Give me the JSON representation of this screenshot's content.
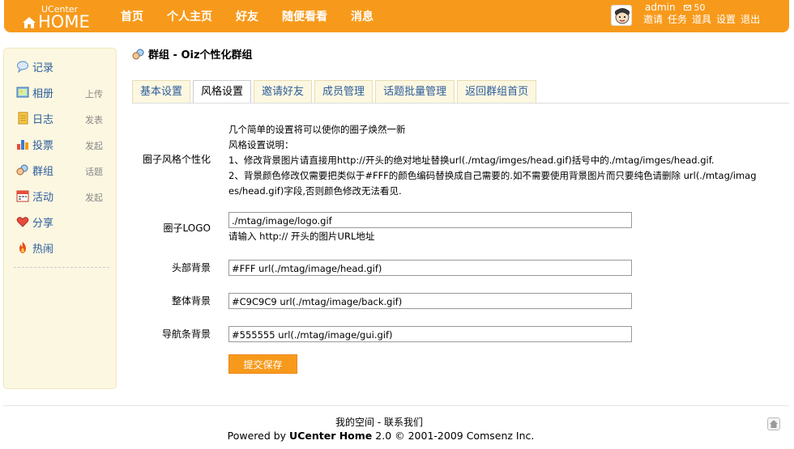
{
  "header": {
    "logo_small": "UCenter",
    "logo_big": "HOME",
    "nav": [
      "首页",
      "个人主页",
      "好友",
      "随便看看",
      "消息"
    ],
    "username": "admin",
    "message_count": "50",
    "user_links": [
      "邀请",
      "任务",
      "道具",
      "设置",
      "退出"
    ]
  },
  "sidebar": {
    "items": [
      {
        "label": "记录",
        "action": "",
        "icon": "speech-bubble-icon"
      },
      {
        "label": "相册",
        "action": "上传",
        "icon": "photo-icon"
      },
      {
        "label": "日志",
        "action": "发表",
        "icon": "notebook-icon"
      },
      {
        "label": "投票",
        "action": "发起",
        "icon": "bar-chart-icon"
      },
      {
        "label": "群组",
        "action": "话题",
        "icon": "group-icon"
      },
      {
        "label": "活动",
        "action": "发起",
        "icon": "calendar-icon"
      },
      {
        "label": "分享",
        "action": "",
        "icon": "heart-icon"
      },
      {
        "label": "热闹",
        "action": "",
        "icon": "fire-icon"
      }
    ]
  },
  "page": {
    "title": "群组 - Oiz个性化群组",
    "tabs": [
      "基本设置",
      "风格设置",
      "邀请好友",
      "成员管理",
      "话题批量管理",
      "返回群组首页"
    ],
    "active_tab": "风格设置"
  },
  "form": {
    "style_label": "圈子风格个性化",
    "style_desc": [
      "几个简单的设置将可以使你的圈子焕然一新",
      "风格设置说明：",
      "1、修改背景图片请直接用http://开头的绝对地址替换url(./mtag/imges/head.gif)括号中的./mtag/imges/head.gif.",
      "2、背景颜色修改仅需要把类似于#FFF的颜色编码替换成自己需要的.如不需要使用背景图片而只要纯色请删除 url(./mtag/imag",
      "es/head.gif)字段,否则颜色修改无法看见."
    ],
    "logo_label": "圈子LOGO",
    "logo_value": "./mtag/image/logo.gif",
    "logo_hint": "请输入 http:// 开头的图片URL地址",
    "head_label": "头部背景",
    "head_value": "#FFF url(./mtag/image/head.gif)",
    "back_label": "整体背景",
    "back_value": "#C9C9C9 url(./mtag/image/back.gif)",
    "nav_label": "导航条背景",
    "nav_value": "#555555 url(./mtag/image/gui.gif)",
    "submit_label": "提交保存"
  },
  "footer": {
    "link_space": "我的空间",
    "link_contact": "联系我们",
    "powered_prefix": "Powered by",
    "powered_brand": "UCenter Home",
    "powered_suffix": "2.0 © 2001-2009 Comsenz Inc."
  },
  "colors": {
    "accent": "#f79a1b",
    "link": "#2c5d9c",
    "sidebar_bg": "#fcf7e1"
  }
}
